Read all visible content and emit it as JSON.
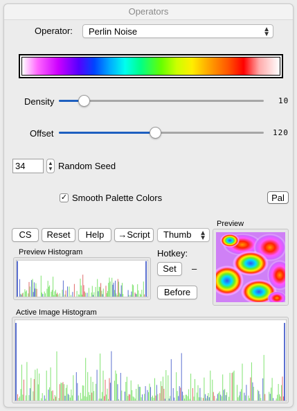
{
  "window": {
    "title": "Operators"
  },
  "operator": {
    "label": "Operator:",
    "selected": "Perlin Noise"
  },
  "density": {
    "label": "Density",
    "value": "10",
    "fraction": 0.12
  },
  "offset": {
    "label": "Offset",
    "value": "120",
    "fraction": 0.47
  },
  "seed": {
    "value": "34",
    "label": "Random Seed"
  },
  "smooth": {
    "label": "Smooth Palette Colors",
    "checked": true
  },
  "buttons": {
    "pal": "Pal",
    "cs": "CS",
    "reset": "Reset",
    "help": "Help",
    "script": "→Script",
    "set": "Set",
    "before": "Before"
  },
  "thumb": {
    "selected": "Thumb"
  },
  "hotkey": {
    "label": "Hotkey:",
    "value": "–"
  },
  "preview": {
    "label": "Preview"
  },
  "preview_histogram": {
    "label": "Preview Histogram"
  },
  "active_histogram": {
    "label": "Active Image Histogram"
  },
  "colors": {
    "accent": "#1d5fbf",
    "hist_green": "#7fe36f",
    "hist_blue": "#5a6fd0",
    "hist_red": "#e06a6a"
  },
  "icons": {
    "popup": "chevron-up-down-icon",
    "stepper": "stepper-arrows-icon",
    "check": "checkmark-icon"
  }
}
